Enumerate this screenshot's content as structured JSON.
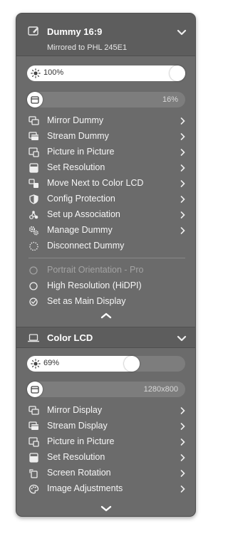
{
  "displays": [
    {
      "title": "Dummy 16:9",
      "subtitle": "Mirrored to PHL 245E1",
      "brightness_label": "100%",
      "brightness_level": 1.0,
      "secondary_value": "16%",
      "secondary_level": 0.0,
      "items": [
        {
          "label": "Mirror Dummy",
          "icon": "mirror-icon"
        },
        {
          "label": "Stream Dummy",
          "icon": "stream-icon"
        },
        {
          "label": "Picture in Picture",
          "icon": "pip-icon"
        },
        {
          "label": "Set Resolution",
          "icon": "resolution-icon"
        },
        {
          "label": "Move Next to Color LCD",
          "icon": "move-icon"
        },
        {
          "label": "Config Protection",
          "icon": "shield-icon"
        },
        {
          "label": "Set up Association",
          "icon": "association-icon"
        },
        {
          "label": "Manage Dummy",
          "icon": "gears-icon"
        },
        {
          "label": "Disconnect Dummy",
          "icon": "disconnect-icon"
        }
      ],
      "options": [
        {
          "label": "Portrait Orientation - Pro",
          "state": "disabled"
        },
        {
          "label": "High Resolution (HiDPI)",
          "state": "off"
        },
        {
          "label": "Set as Main Display",
          "state": "checked"
        }
      ]
    },
    {
      "title": "Color LCD",
      "brightness_label": "69%",
      "brightness_level": 0.69,
      "secondary_value": "1280x800",
      "items": [
        {
          "label": "Mirror Display",
          "icon": "mirror-icon"
        },
        {
          "label": "Stream Display",
          "icon": "stream-icon"
        },
        {
          "label": "Picture in Picture",
          "icon": "pip-icon"
        },
        {
          "label": "Set Resolution",
          "icon": "resolution-icon"
        },
        {
          "label": "Screen Rotation",
          "icon": "rotation-icon"
        },
        {
          "label": "Image Adjustments",
          "icon": "palette-icon"
        }
      ]
    }
  ]
}
